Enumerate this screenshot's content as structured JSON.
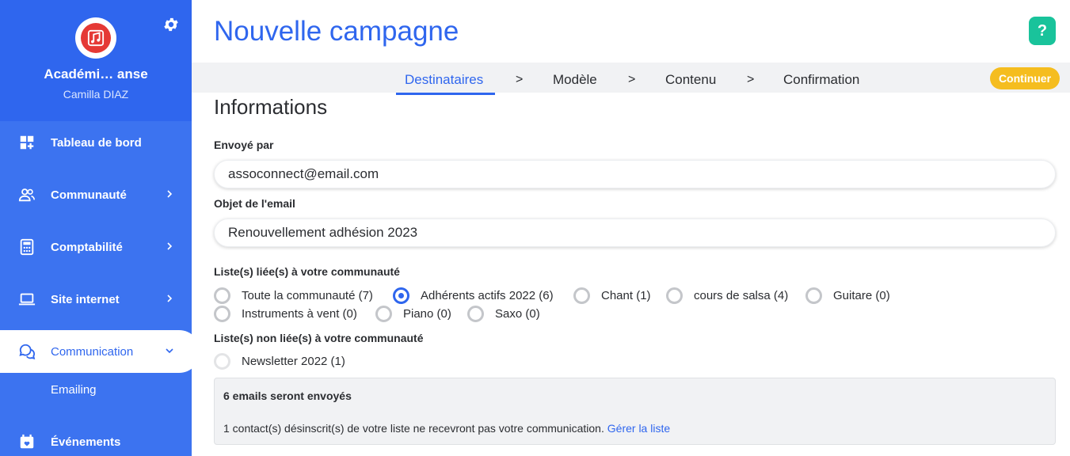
{
  "sidebar": {
    "org_name": "Académi… anse",
    "user_name": "Camilla DIAZ",
    "items": [
      {
        "label": "Tableau de bord"
      },
      {
        "label": "Communauté"
      },
      {
        "label": "Comptabilité"
      },
      {
        "label": "Site internet"
      },
      {
        "label": "Communication"
      },
      {
        "label": "Événements"
      }
    ],
    "sub_items": [
      {
        "label": "Emailing"
      }
    ]
  },
  "header": {
    "title": "Nouvelle campagne",
    "help_label": "?"
  },
  "steps": {
    "items": [
      "Destinataires",
      "Modèle",
      "Contenu",
      "Confirmation"
    ],
    "separator": ">",
    "continue_label": "Continuer"
  },
  "form": {
    "section_title": "Informations",
    "sender_label": "Envoyé par",
    "sender_value": "assoconnect@email.com",
    "subject_label": "Objet de l'email",
    "subject_value": "Renouvellement adhésion 2023",
    "linked_lists_label": "Liste(s) liée(s) à votre communauté",
    "linked_lists": [
      "Toute la communauté (7)",
      "Adhérents actifs 2022 (6)",
      "Chant (1)",
      "cours de salsa (4)",
      "Guitare (0)",
      "Instruments à vent (0)",
      "Piano (0)",
      "Saxo (0)"
    ],
    "selected_list": "Adhérents actifs 2022 (6)",
    "unlinked_lists_label": "Liste(s) non liée(s) à votre communauté",
    "unlinked_lists": [
      "Newsletter 2022 (1)"
    ]
  },
  "summary": {
    "title": "6 emails seront envoyés",
    "text": "1 contact(s) désinscrit(s) de votre liste ne recevront pas votre communication.",
    "link": "Gérer la liste"
  },
  "colors": {
    "primary": "#2f66ee",
    "sidebar": "#3c73f0",
    "help": "#19c39b",
    "continue": "#f5bd1f"
  }
}
